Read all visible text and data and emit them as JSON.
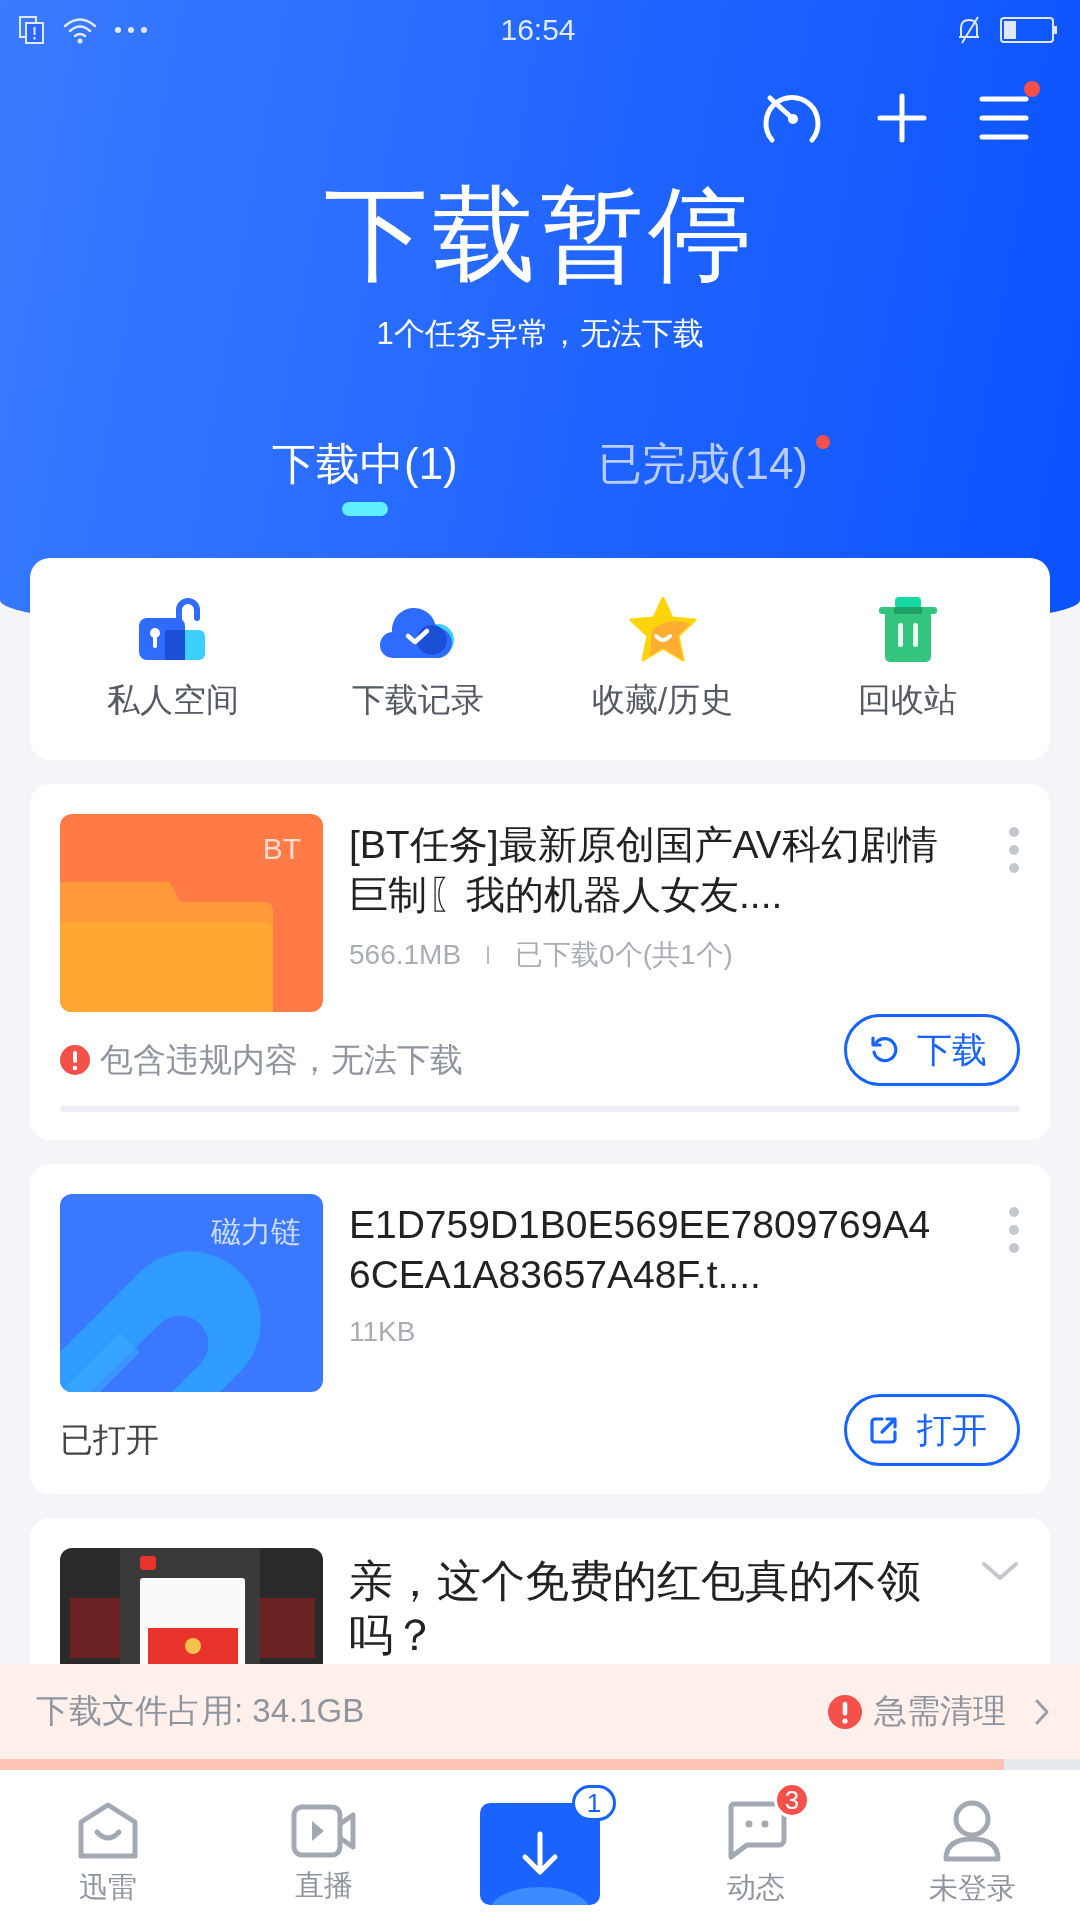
{
  "status_bar": {
    "time": "16:54"
  },
  "header": {
    "menu_badge": true,
    "title": "下载暂停",
    "subtitle": "1个任务异常，无法下载"
  },
  "tabs": [
    {
      "label": "下载中(1)",
      "selected": true,
      "dot": false
    },
    {
      "label": "已完成(14)",
      "selected": false,
      "dot": true
    }
  ],
  "shortcuts": [
    {
      "label": "私人空间",
      "kind": "lock"
    },
    {
      "label": "下载记录",
      "kind": "cloud"
    },
    {
      "label": "收藏/历史",
      "kind": "star"
    },
    {
      "label": "回收站",
      "kind": "trash"
    }
  ],
  "tasks": [
    {
      "kind": "bt",
      "thumb_label": "BT",
      "title": "[BT任务]最新原创国产AV科幻剧情巨制〖我的机器人女友....",
      "size": "566.1MB",
      "detail": "已下载0个(共1个)",
      "status": "包含违规内容，无法下载",
      "error": true,
      "action": {
        "label": "下载",
        "kind": "retry"
      }
    },
    {
      "kind": "magnet",
      "thumb_label": "磁力链",
      "title": "E1D759D1B0E569EE7809769A46CEA1A83657A48F.t....",
      "size": "11KB",
      "status": "已打开",
      "error": false,
      "action": {
        "label": "打开",
        "kind": "open"
      }
    },
    {
      "kind": "ad",
      "title": "亲，这个免费的红包真的不领吗？"
    }
  ],
  "storage": {
    "label": "下载文件占用: 34.1GB",
    "warning": "急需清理",
    "level": 0.93
  },
  "nav": [
    {
      "label": "迅雷",
      "kind": "home",
      "selected": false
    },
    {
      "label": "直播",
      "kind": "video",
      "selected": false
    },
    {
      "kind": "download",
      "selected": true,
      "badge": "1"
    },
    {
      "label": "动态",
      "kind": "chat",
      "selected": false,
      "badge": "3"
    },
    {
      "label": "未登录",
      "kind": "user",
      "selected": false
    }
  ]
}
